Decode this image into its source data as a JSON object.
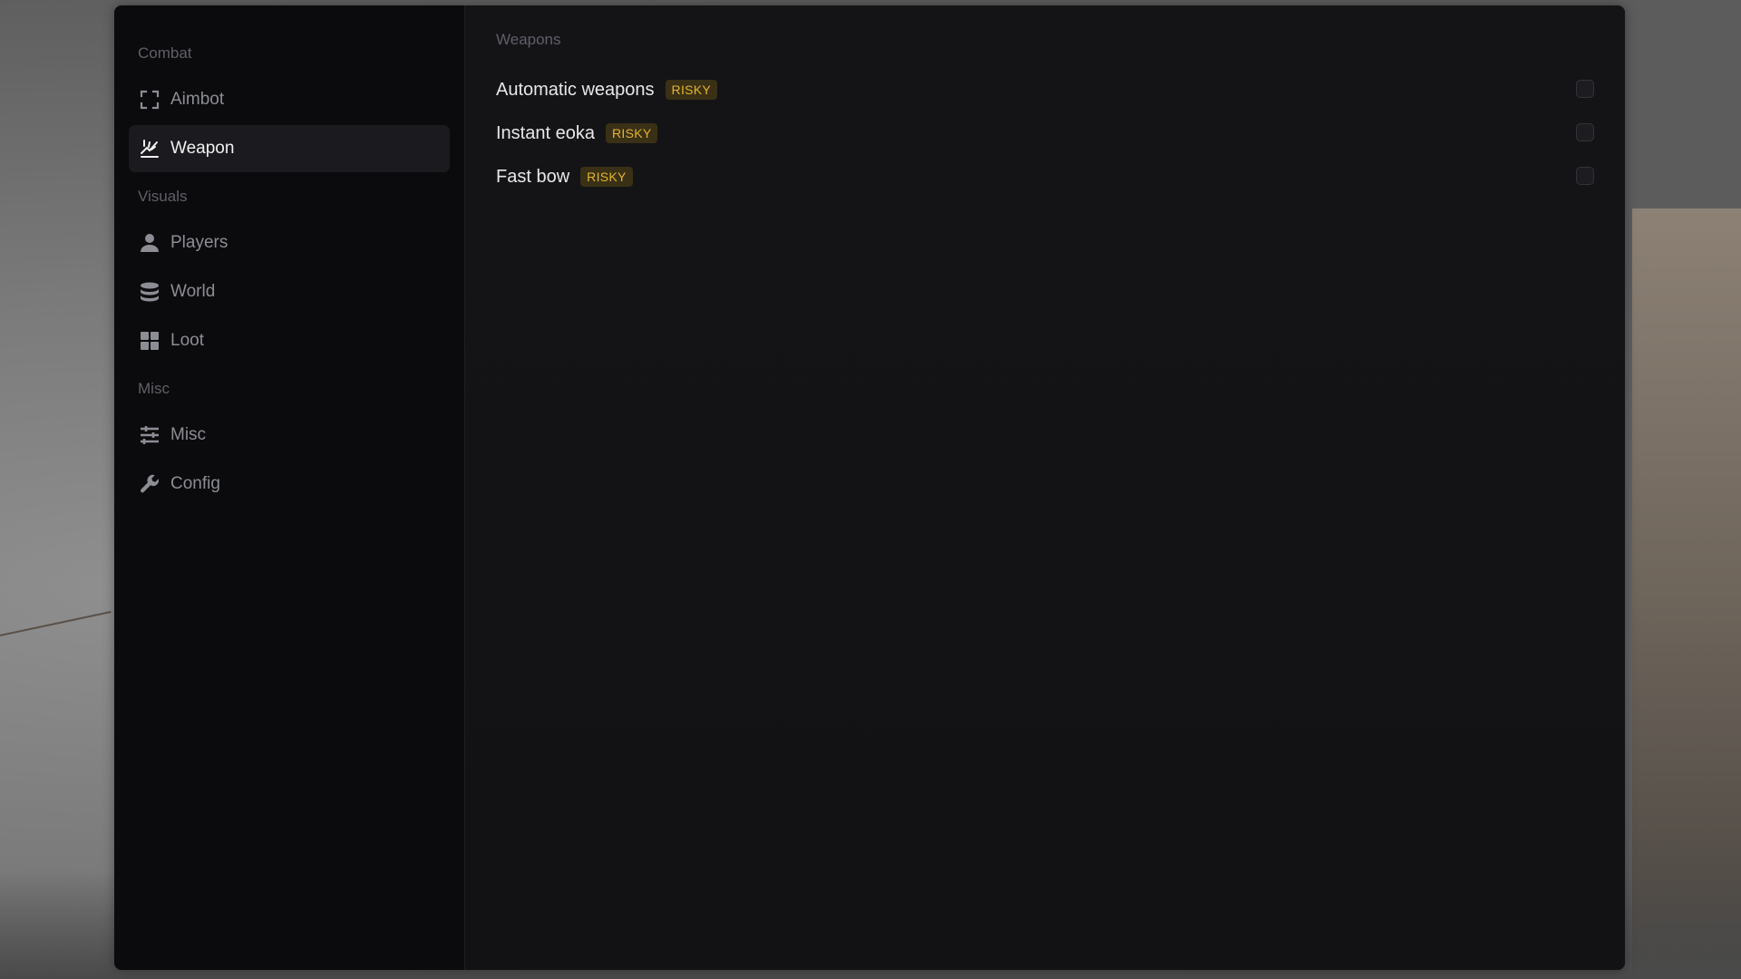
{
  "sidebar": {
    "groups": [
      {
        "label": "Combat",
        "items": [
          {
            "label": "Aimbot",
            "icon": "crosshair-frame-icon",
            "active": false
          },
          {
            "label": "Weapon",
            "icon": "weapon-icon",
            "active": true
          }
        ]
      },
      {
        "label": "Visuals",
        "items": [
          {
            "label": "Players",
            "icon": "user-icon",
            "active": false
          },
          {
            "label": "World",
            "icon": "database-icon",
            "active": false
          },
          {
            "label": "Loot",
            "icon": "grid-icon",
            "active": false
          }
        ]
      },
      {
        "label": "Misc",
        "items": [
          {
            "label": "Misc",
            "icon": "sliders-icon",
            "active": false
          },
          {
            "label": "Config",
            "icon": "wrench-icon",
            "active": false
          }
        ]
      }
    ]
  },
  "main": {
    "section_title": "Weapons",
    "features": [
      {
        "label": "Automatic weapons",
        "badge": "RISKY",
        "checked": false
      },
      {
        "label": "Instant eoka",
        "badge": "RISKY",
        "checked": false
      },
      {
        "label": "Fast bow",
        "badge": "RISKY",
        "checked": false
      }
    ]
  },
  "colors": {
    "window_bg": "#141416",
    "sidebar_bg": "#0b0b0d",
    "active_item_bg": "#1b1b1f",
    "badge_bg": "#3a3015",
    "badge_text": "#e3b42e",
    "muted_text": "#5f6068"
  }
}
